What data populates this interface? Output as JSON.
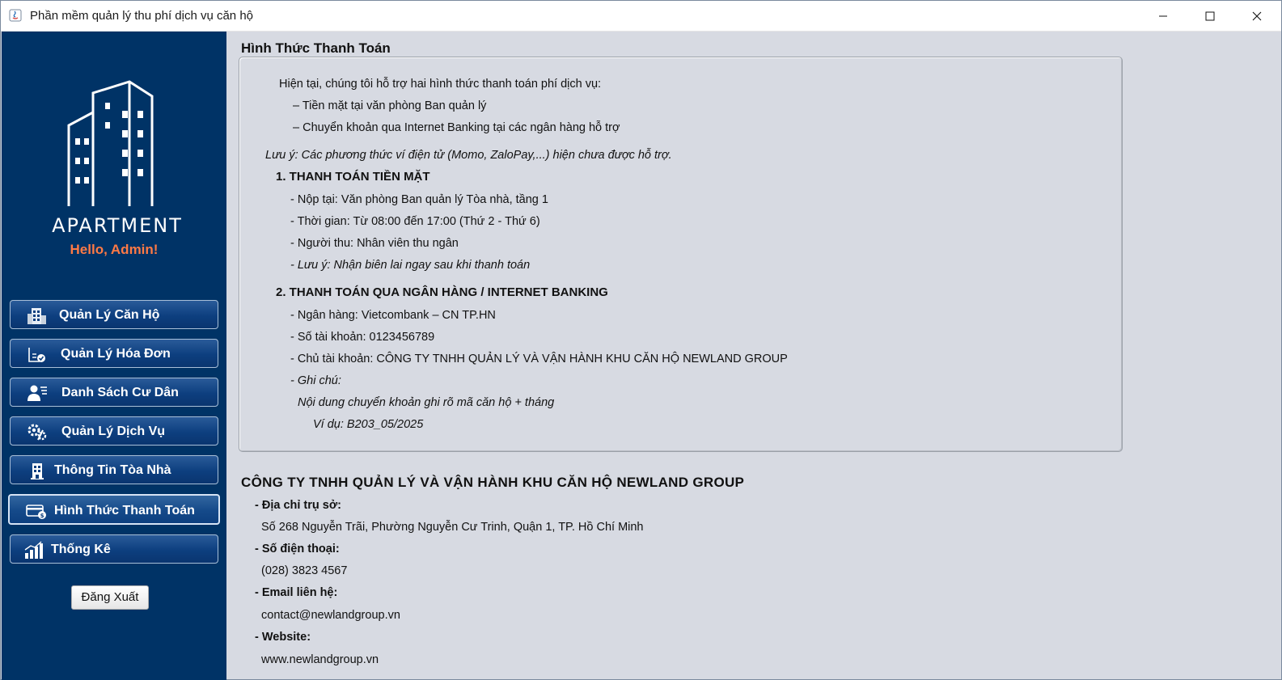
{
  "window": {
    "title": "Phần mềm quản lý thu phí dịch vụ căn hộ"
  },
  "sidebar": {
    "logo_text": "APARTMENT",
    "greeting": "Hello, Admin!",
    "items": [
      {
        "label": "Quản Lý Căn Hộ",
        "icon": "building-icon"
      },
      {
        "label": "Quản Lý Hóa Đơn",
        "icon": "invoice-icon"
      },
      {
        "label": "Danh Sách Cư Dân",
        "icon": "resident-list-icon"
      },
      {
        "label": "Quản Lý Dịch Vụ",
        "icon": "service-gears-icon"
      },
      {
        "label": "Thông Tin Tòa Nhà",
        "icon": "tower-icon"
      },
      {
        "label": "Hình Thức Thanh Toán",
        "icon": "payment-card-icon",
        "active": true
      },
      {
        "label": "Thống Kê",
        "icon": "bar-chart-icon"
      }
    ],
    "logout_label": "Đăng Xuất"
  },
  "main": {
    "section_title": "Hình Thức Thanh Toán",
    "intro": "Hiện tại, chúng tôi hỗ trợ hai hình thức thanh toán phí dịch vụ:",
    "options": [
      "– Tiền mặt tại văn phòng Ban quản lý",
      "– Chuyển khoản qua Internet Banking tại các ngân hàng hỗ trợ"
    ],
    "note": "Lưu ý: Các phương thức ví điện tử (Momo, ZaloPay,...) hiện chưa được hỗ trợ.",
    "cash": {
      "heading": "1. THANH TOÁN TIỀN MẶT",
      "place": "- Nộp tại: Văn phòng Ban quản lý Tòa nhà, tầng 1",
      "time": "- Thời gian: Từ 08:00 đến 17:00 (Thứ 2 - Thứ 6)",
      "collector": "- Người thu: Nhân viên thu ngân",
      "note": "- Lưu ý: Nhận biên lai ngay sau khi thanh toán"
    },
    "bank": {
      "heading": "2. THANH TOÁN QUA NGÂN HÀNG / INTERNET BANKING",
      "bank_name": "- Ngân hàng: Vietcombank – CN TP.HN",
      "account_no": "- Số tài khoản: 0123456789",
      "holder": "- Chủ tài khoản: CÔNG TY TNHH QUẢN LÝ VÀ VẬN HÀNH KHU CĂN HỘ NEWLAND GROUP",
      "note_label": "- Ghi chú:",
      "note_text": "Nội dung chuyển khoản ghi rõ mã căn hộ + tháng",
      "example": "Ví dụ: B203_05/2025"
    }
  },
  "company": {
    "name": "CÔNG TY TNHH QUẢN LÝ VÀ VẬN HÀNH KHU CĂN HỘ NEWLAND GROUP",
    "address_label": "- Địa chỉ trụ sở:",
    "address": "Số 268 Nguyễn Trãi, Phường Nguyễn Cư Trinh, Quận 1, TP. Hồ Chí Minh",
    "phone_label": "- Số điện thoại:",
    "phone": "(028) 3823 4567",
    "email_label": "- Email liên hệ:",
    "email": "contact@newlandgroup.vn",
    "website_label": "- Website:",
    "website": "www.newlandgroup.vn"
  },
  "colors": {
    "sidebar_bg": "#003366",
    "greeting": "#ff7a45",
    "content_bg": "#d7dae2"
  }
}
